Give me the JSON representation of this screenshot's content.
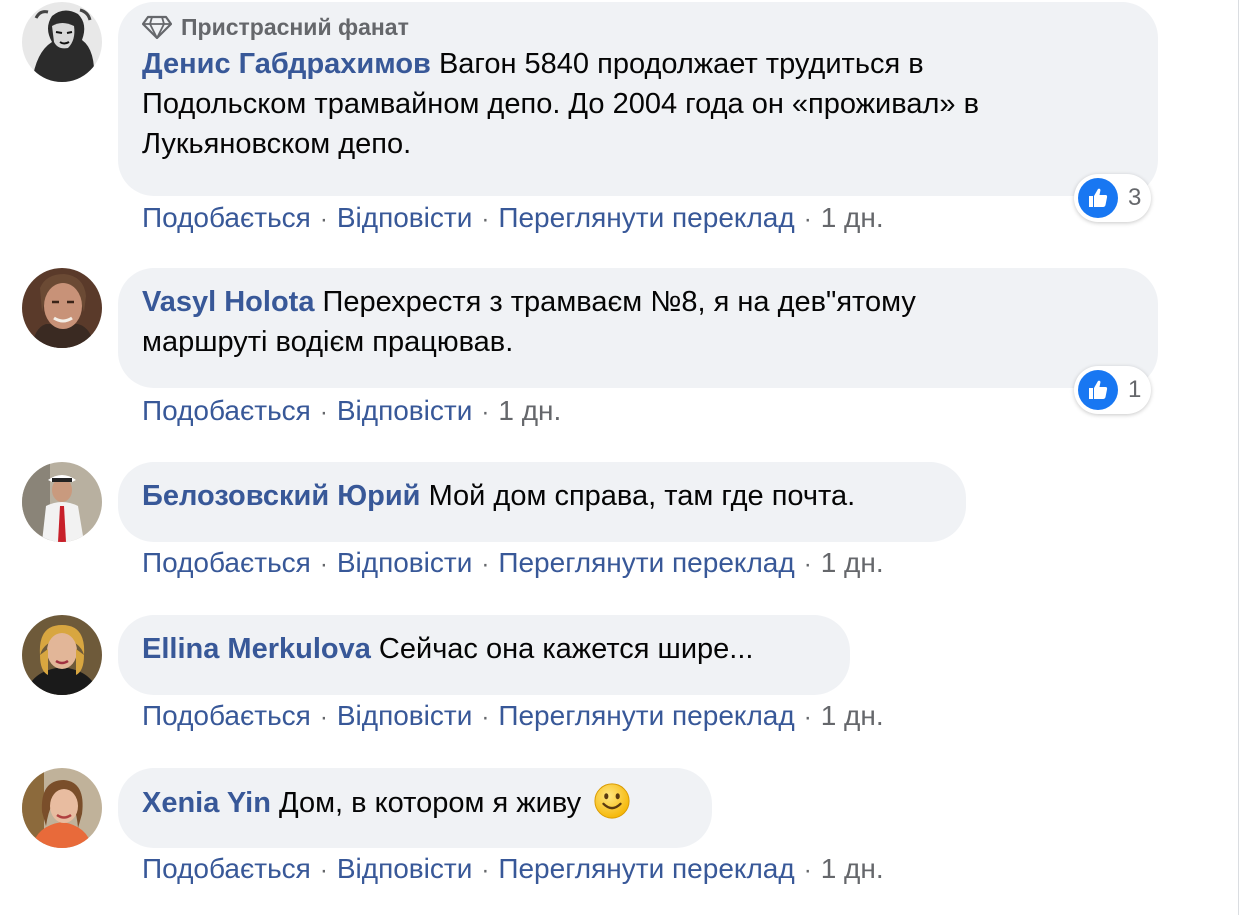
{
  "badge": {
    "label": "Пристрасний фанат",
    "icon": "diamond-icon"
  },
  "colors": {
    "author": "#385898",
    "link": "#385898",
    "meta": "#65676b",
    "bubble": "#f0f2f5",
    "like": "#1877f2"
  },
  "actions": {
    "like": "Подобається",
    "reply": "Відповісти",
    "translate": "Переглянути переклад",
    "separator": "·"
  },
  "comments": [
    {
      "author": "Денис Габдрахимов",
      "text": "Вагон 5840 продолжает трудиться в",
      "text2": "Подольском трамвайном депо. До 2004 года он «проживал» в",
      "text3": "Лукьяновском депо.",
      "time": "1 дн.",
      "likes": "3"
    },
    {
      "author": "Vasyl Holota",
      "text": "Перехрестя з трамваєм №8, я на дев\"ятому",
      "text2": "маршруті водієм працював.",
      "time": "1 дн.",
      "likes": "1"
    },
    {
      "author": "Белозовский Юрий",
      "text": "Мой дом справа, там где почта.",
      "time": "1 дн."
    },
    {
      "author": "Ellina Merkulova",
      "text": "Сейчас она кажется шире...",
      "time": "1 дн."
    },
    {
      "author": "Xenia Yin",
      "text": "Дом, в котором я живу",
      "emoji": "smiley-emoji",
      "time": "1 дн."
    }
  ]
}
